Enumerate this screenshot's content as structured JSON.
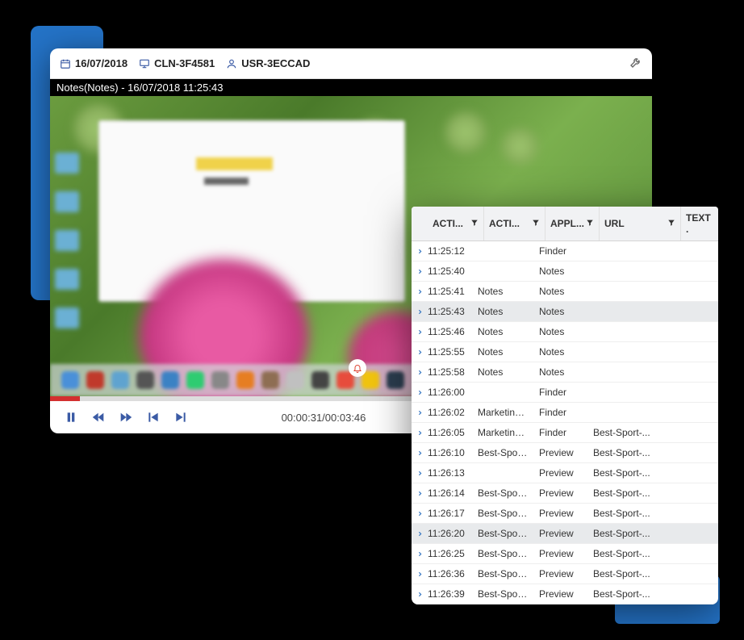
{
  "header": {
    "date": "16/07/2018",
    "client": "CLN-3F4581",
    "user": "USR-3ECCAD"
  },
  "title_bar": "Notes(Notes) - 16/07/2018 11:25:43",
  "player": {
    "time": "00:00:31/00:03:46"
  },
  "table": {
    "columns": {
      "time": "ACTI...",
      "activity": "ACTI...",
      "app": "APPL...",
      "url": "URL",
      "text": "TEXT ."
    },
    "rows": [
      {
        "time": "11:25:12",
        "activity": "",
        "app": "Finder",
        "url": "",
        "selected": false
      },
      {
        "time": "11:25:40",
        "activity": "",
        "app": "Notes",
        "url": "",
        "selected": false
      },
      {
        "time": "11:25:41",
        "activity": "Notes",
        "app": "Notes",
        "url": "",
        "selected": false
      },
      {
        "time": "11:25:43",
        "activity": "Notes",
        "app": "Notes",
        "url": "",
        "selected": true
      },
      {
        "time": "11:25:46",
        "activity": "Notes",
        "app": "Notes",
        "url": "",
        "selected": false
      },
      {
        "time": "11:25:55",
        "activity": "Notes",
        "app": "Notes",
        "url": "",
        "selected": false
      },
      {
        "time": "11:25:58",
        "activity": "Notes",
        "app": "Notes",
        "url": "",
        "selected": false
      },
      {
        "time": "11:26:00",
        "activity": "",
        "app": "Finder",
        "url": "",
        "selected": false
      },
      {
        "time": "11:26:02",
        "activity": "Marketing_b...",
        "app": "Finder",
        "url": "",
        "selected": false
      },
      {
        "time": "11:26:05",
        "activity": "Marketing_b...",
        "app": "Finder",
        "url": "Best-Sport-...",
        "selected": false
      },
      {
        "time": "11:26:10",
        "activity": "Best-Sport-...",
        "app": "Preview",
        "url": "Best-Sport-...",
        "selected": false
      },
      {
        "time": "11:26:13",
        "activity": "",
        "app": "Preview",
        "url": "Best-Sport-...",
        "selected": false
      },
      {
        "time": "11:26:14",
        "activity": "Best-Sport-...",
        "app": "Preview",
        "url": "Best-Sport-...",
        "selected": false
      },
      {
        "time": "11:26:17",
        "activity": "Best-Sport-...",
        "app": "Preview",
        "url": "Best-Sport-...",
        "selected": false
      },
      {
        "time": "11:26:20",
        "activity": "Best-Sport-...",
        "app": "Preview",
        "url": "Best-Sport-...",
        "selected": true
      },
      {
        "time": "11:26:25",
        "activity": "Best-Sport-...",
        "app": "Preview",
        "url": "Best-Sport-...",
        "selected": false
      },
      {
        "time": "11:26:36",
        "activity": "Best-Sport-...",
        "app": "Preview",
        "url": "Best-Sport-...",
        "selected": false
      },
      {
        "time": "11:26:39",
        "activity": "Best-Sport-...",
        "app": "Preview",
        "url": "Best-Sport-...",
        "selected": false
      }
    ]
  }
}
